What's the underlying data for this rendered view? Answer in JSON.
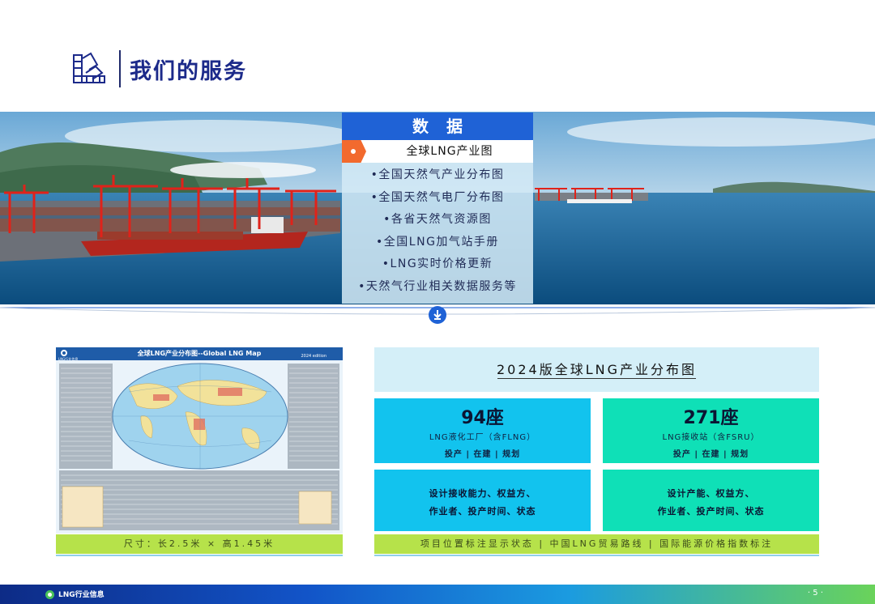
{
  "header": {
    "title": "我们的服务",
    "icon": "swatch-chart-icon"
  },
  "services_panel": {
    "heading": "数据",
    "active_item": "全球LNG产业图",
    "items": [
      "•全国天然气产业分布图",
      "•全国天然气电厂分布图",
      "•各省天然气资源图",
      "•全国LNG加气站手册",
      "•LNG实时价格更新",
      "•天然气行业相关数据服务等"
    ]
  },
  "map": {
    "title": "全球LNG产业分布图--Global LNG Map",
    "edition": "2024 edition",
    "logo_text": "LNG行业信息",
    "size_label": "尺寸：长2.5米 × 高1.45米"
  },
  "product": {
    "title": "2024版全球LNG产业分布图",
    "stats": [
      {
        "value": "94座",
        "label": "LNG液化工厂（含FLNG）",
        "status": "投产 | 在建 | 规划",
        "color": "#12c3ee"
      },
      {
        "value": "271座",
        "label": "LNG接收站（含FSRU）",
        "status": "投产 | 在建 | 规划",
        "color": "#0fe0b7"
      }
    ],
    "details": [
      {
        "line1": "设计接收能力、权益方、",
        "line2": "作业者、投产时间、状态"
      },
      {
        "line1": "设计产能、权益方、",
        "line2": "作业者、投产时间、状态"
      }
    ],
    "features": "项目位置标注显示状态 | 中国LNG贸易路线 | 国际能源价格指数标注"
  },
  "footer": {
    "brand": "LNG行业信息",
    "page": "· 5 ·"
  },
  "colors": {
    "primary_blue": "#1f62d6",
    "accent_orange": "#f26a2e",
    "cyan": "#12c3ee",
    "teal": "#0fe0b7",
    "lime": "#b6e24a"
  }
}
